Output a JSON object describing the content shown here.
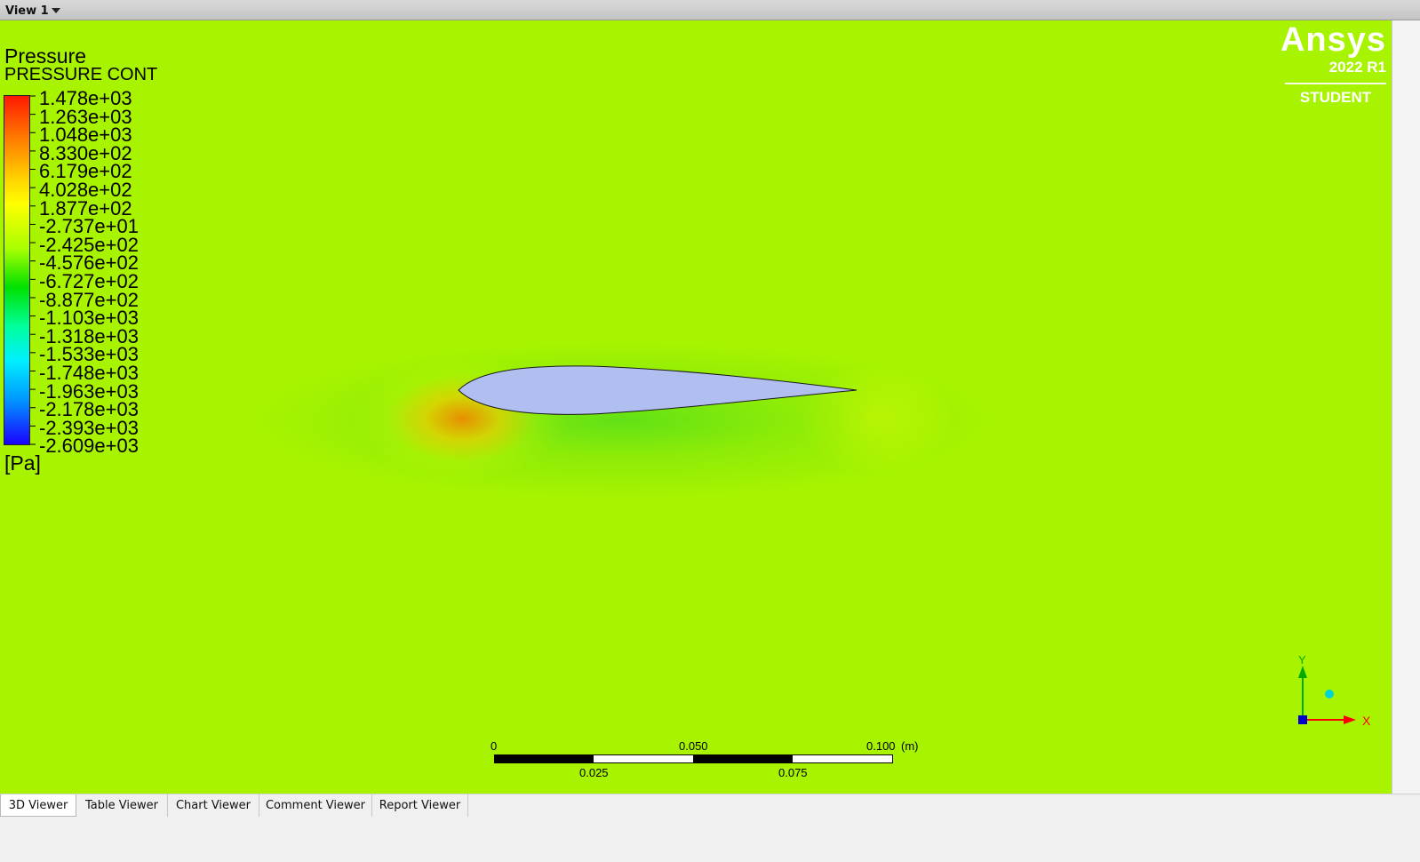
{
  "view": {
    "title": "View 1"
  },
  "legend": {
    "title": "Pressure",
    "subtitle": "PRESSURE CONT",
    "unit": "[Pa]",
    "values": [
      "1.478e+03",
      "1.263e+03",
      "1.048e+03",
      "8.330e+02",
      "6.179e+02",
      "4.028e+02",
      "1.877e+02",
      "-2.737e+01",
      "-2.425e+02",
      "-4.576e+02",
      "-6.727e+02",
      "-8.877e+02",
      "-1.103e+03",
      "-1.318e+03",
      "-1.533e+03",
      "-1.748e+03",
      "-1.963e+03",
      "-2.178e+03",
      "-2.393e+03",
      "-2.609e+03"
    ]
  },
  "logo": {
    "name": "Ansys",
    "version": "2022 R1",
    "edition": "STUDENT"
  },
  "scale_bar": {
    "top_labels": [
      "0",
      "0.050",
      "0.100"
    ],
    "unit": "(m)",
    "bottom_labels": [
      "0.025",
      "0.075"
    ]
  },
  "axes": {
    "y_label": "Y",
    "x_label": "X"
  },
  "tabs": [
    {
      "label": "3D Viewer",
      "active": true
    },
    {
      "label": "Table Viewer",
      "active": false
    },
    {
      "label": "Chart Viewer",
      "active": false
    },
    {
      "label": "Comment Viewer",
      "active": false
    },
    {
      "label": "Report Viewer",
      "active": false
    }
  ],
  "colors": {
    "background_field": "#a8f400",
    "airfoil_fill": "#b0bff0",
    "x_axis": "#ff0000",
    "y_axis": "#00aa00"
  }
}
